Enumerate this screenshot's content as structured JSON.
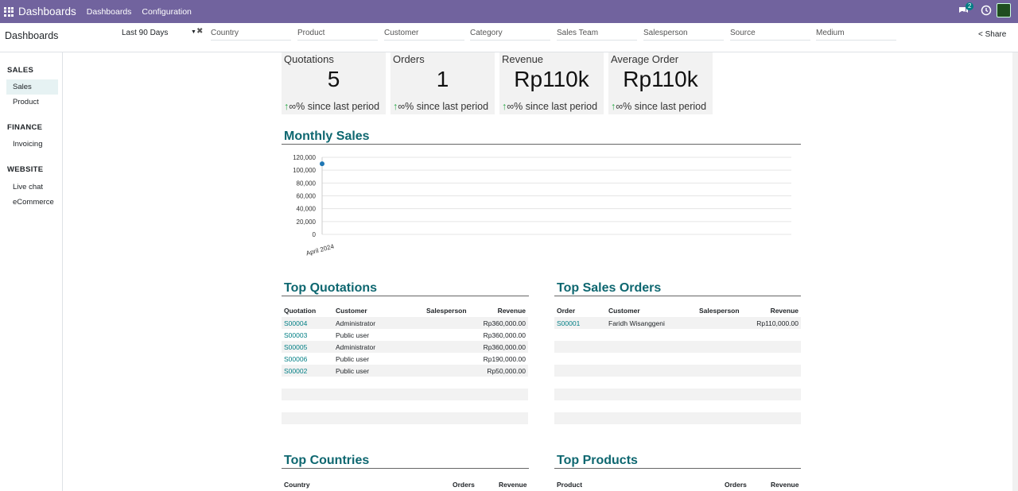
{
  "navbar": {
    "brand": "Dashboards",
    "menu": [
      "Dashboards",
      "Configuration"
    ],
    "chat_count": "2"
  },
  "control": {
    "title": "Dashboards",
    "date_filter": "Last 90 Days",
    "filters": [
      "Country",
      "Product",
      "Customer",
      "Category",
      "Sales Team",
      "Salesperson",
      "Source",
      "Medium"
    ],
    "share": "Share"
  },
  "sidebar": {
    "groups": [
      {
        "label": "SALES",
        "items": [
          "Sales",
          "Product"
        ]
      },
      {
        "label": "FINANCE",
        "items": [
          "Invoicing"
        ]
      },
      {
        "label": "WEBSITE",
        "items": [
          "Live chat",
          "eCommerce"
        ]
      }
    ]
  },
  "kpis": [
    {
      "label": "Quotations",
      "value": "5",
      "trend": "∞% since last period"
    },
    {
      "label": "Orders",
      "value": "1",
      "trend": "∞% since last period"
    },
    {
      "label": "Revenue",
      "value": "Rp110k",
      "trend": "∞% since last period"
    },
    {
      "label": "Average Order",
      "value": "Rp110k",
      "trend": "∞% since last period"
    }
  ],
  "monthly_sales": {
    "title": "Monthly Sales"
  },
  "chart_data": {
    "type": "line",
    "title": "Monthly Sales",
    "categories": [
      "April 2024"
    ],
    "series": [
      {
        "values": [
          110000
        ]
      }
    ],
    "yticks": [
      "120,000",
      "100,000",
      "80,000",
      "60,000",
      "40,000",
      "20,000",
      "0"
    ],
    "ylim": [
      0,
      120000
    ],
    "series_color": "#1f77b4"
  },
  "top_quotations": {
    "title": "Top Quotations",
    "headers": [
      "Quotation",
      "Customer",
      "Salesperson",
      "Revenue"
    ],
    "rows": [
      [
        "S00004",
        "Administrator",
        "",
        "Rp360,000.00"
      ],
      [
        "S00003",
        "Public user",
        "",
        "Rp360,000.00"
      ],
      [
        "S00005",
        "Administrator",
        "",
        "Rp360,000.00"
      ],
      [
        "S00006",
        "Public user",
        "",
        "Rp190,000.00"
      ],
      [
        "S00002",
        "Public user",
        "",
        "Rp50,000.00"
      ]
    ]
  },
  "top_sales_orders": {
    "title": "Top Sales Orders",
    "headers": [
      "Order",
      "Customer",
      "Salesperson",
      "Revenue"
    ],
    "rows": [
      [
        "S00001",
        "Faridh Wisanggeni",
        "",
        "Rp110,000.00"
      ]
    ]
  },
  "top_countries": {
    "title": "Top Countries",
    "headers": [
      "Country",
      "Orders",
      "Revenue"
    ]
  },
  "top_products": {
    "title": "Top Products",
    "headers": [
      "Product",
      "Orders",
      "Revenue"
    ]
  }
}
